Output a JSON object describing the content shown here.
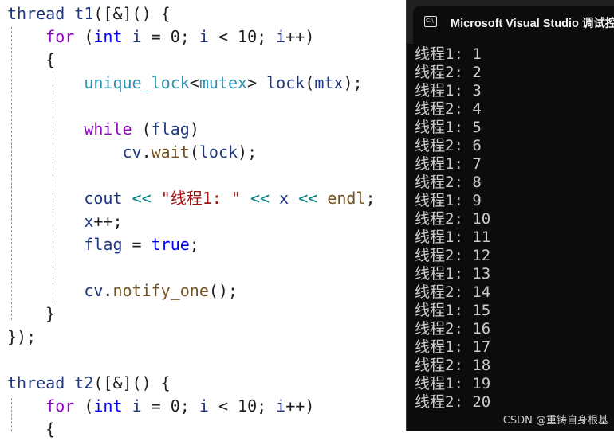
{
  "editor": {
    "lines": [
      [
        {
          "t": "thread ",
          "c": "var"
        },
        {
          "t": "t1",
          "c": "var"
        },
        {
          "t": "([&]() {",
          "c": "punc"
        }
      ],
      [
        {
          "t": "    ",
          "c": "punc"
        },
        {
          "t": "for",
          "c": "kw-ctrl"
        },
        {
          "t": " (",
          "c": "punc"
        },
        {
          "t": "int",
          "c": "kw-type"
        },
        {
          "t": " ",
          "c": "punc"
        },
        {
          "t": "i",
          "c": "var"
        },
        {
          "t": " = 0; ",
          "c": "punc"
        },
        {
          "t": "i",
          "c": "var"
        },
        {
          "t": " < 10; ",
          "c": "punc"
        },
        {
          "t": "i",
          "c": "var"
        },
        {
          "t": "++)",
          "c": "punc"
        }
      ],
      [
        {
          "t": "    {",
          "c": "punc"
        }
      ],
      [
        {
          "t": "        ",
          "c": "punc"
        },
        {
          "t": "unique_lock",
          "c": "type"
        },
        {
          "t": "<",
          "c": "punc"
        },
        {
          "t": "mutex",
          "c": "type"
        },
        {
          "t": "> ",
          "c": "punc"
        },
        {
          "t": "lock",
          "c": "var"
        },
        {
          "t": "(",
          "c": "punc"
        },
        {
          "t": "mtx",
          "c": "var"
        },
        {
          "t": ");",
          "c": "punc"
        }
      ],
      [],
      [
        {
          "t": "        ",
          "c": "punc"
        },
        {
          "t": "while",
          "c": "kw-ctrl"
        },
        {
          "t": " (",
          "c": "punc"
        },
        {
          "t": "flag",
          "c": "var"
        },
        {
          "t": ")",
          "c": "punc"
        }
      ],
      [
        {
          "t": "            ",
          "c": "punc"
        },
        {
          "t": "cv",
          "c": "var"
        },
        {
          "t": ".",
          "c": "punc"
        },
        {
          "t": "wait",
          "c": "fn"
        },
        {
          "t": "(",
          "c": "punc"
        },
        {
          "t": "lock",
          "c": "var"
        },
        {
          "t": ");",
          "c": "punc"
        }
      ],
      [],
      [
        {
          "t": "        ",
          "c": "punc"
        },
        {
          "t": "cout",
          "c": "var"
        },
        {
          "t": " ",
          "c": "punc"
        },
        {
          "t": "<<",
          "c": "op"
        },
        {
          "t": " ",
          "c": "punc"
        },
        {
          "t": "\"线程1: \"",
          "c": "str"
        },
        {
          "t": " ",
          "c": "punc"
        },
        {
          "t": "<<",
          "c": "op"
        },
        {
          "t": " ",
          "c": "punc"
        },
        {
          "t": "x",
          "c": "var"
        },
        {
          "t": " ",
          "c": "punc"
        },
        {
          "t": "<<",
          "c": "op"
        },
        {
          "t": " ",
          "c": "punc"
        },
        {
          "t": "endl",
          "c": "fn"
        },
        {
          "t": ";",
          "c": "punc"
        }
      ],
      [
        {
          "t": "        ",
          "c": "punc"
        },
        {
          "t": "x",
          "c": "var"
        },
        {
          "t": "++;",
          "c": "punc"
        }
      ],
      [
        {
          "t": "        ",
          "c": "punc"
        },
        {
          "t": "flag",
          "c": "var"
        },
        {
          "t": " = ",
          "c": "punc"
        },
        {
          "t": "true",
          "c": "kw-type"
        },
        {
          "t": ";",
          "c": "punc"
        }
      ],
      [],
      [
        {
          "t": "        ",
          "c": "punc"
        },
        {
          "t": "cv",
          "c": "var"
        },
        {
          "t": ".",
          "c": "punc"
        },
        {
          "t": "notify_one",
          "c": "fn"
        },
        {
          "t": "();",
          "c": "punc"
        }
      ],
      [
        {
          "t": "    }",
          "c": "punc"
        }
      ],
      [
        {
          "t": "});",
          "c": "punc"
        }
      ],
      [],
      [
        {
          "t": "thread ",
          "c": "var"
        },
        {
          "t": "t2",
          "c": "var"
        },
        {
          "t": "([&]() {",
          "c": "punc"
        }
      ],
      [
        {
          "t": "    ",
          "c": "punc"
        },
        {
          "t": "for",
          "c": "kw-ctrl"
        },
        {
          "t": " (",
          "c": "punc"
        },
        {
          "t": "int",
          "c": "kw-type"
        },
        {
          "t": " ",
          "c": "punc"
        },
        {
          "t": "i",
          "c": "var"
        },
        {
          "t": " = 0; ",
          "c": "punc"
        },
        {
          "t": "i",
          "c": "var"
        },
        {
          "t": " < 10; ",
          "c": "punc"
        },
        {
          "t": "i",
          "c": "var"
        },
        {
          "t": "++)",
          "c": "punc"
        }
      ],
      [
        {
          "t": "    {",
          "c": "punc"
        }
      ]
    ]
  },
  "console": {
    "title": "Microsoft Visual Studio 调试控",
    "icon": "console-app-icon",
    "output": [
      "线程1: 1",
      "线程2: 2",
      "线程1: 3",
      "线程2: 4",
      "线程1: 5",
      "线程2: 6",
      "线程1: 7",
      "线程2: 8",
      "线程1: 9",
      "线程2: 10",
      "线程1: 11",
      "线程2: 12",
      "线程1: 13",
      "线程2: 14",
      "线程1: 15",
      "线程2: 16",
      "线程1: 17",
      "线程2: 18",
      "线程1: 19",
      "线程2: 20"
    ]
  },
  "watermark": "CSDN @重铸自身根基",
  "colors": {
    "editor_bg": "#ffffff",
    "console_bg": "#0c0c0c",
    "console_titlebar": "#202020",
    "console_text": "#cccccc",
    "keyword_control": "#8f08c4",
    "keyword_type": "#0000ff",
    "identifier": "#1f377f",
    "function": "#74531f",
    "type_name": "#2b91af",
    "string": "#a31515",
    "operator": "#008080"
  }
}
